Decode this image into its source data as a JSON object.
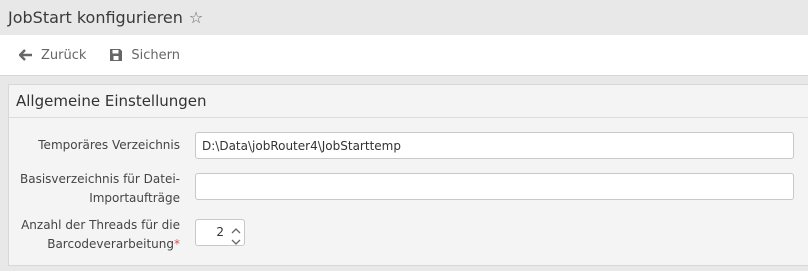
{
  "header": {
    "title": "JobStart konfigurieren",
    "star_icon": "star-outline-icon"
  },
  "toolbar": {
    "back_label": "Zurück",
    "back_icon": "arrow-left-icon",
    "save_label": "Sichern",
    "save_icon": "floppy-disk-icon"
  },
  "section": {
    "title": "Allgemeine Einstellungen"
  },
  "fields": {
    "temp_dir": {
      "label": "Temporäres Verzeichnis",
      "value": "D:\\Data\\jobRouter4\\JobStarttemp",
      "placeholder": ""
    },
    "base_dir": {
      "label_line1": "Basisverzeichnis für Datei-",
      "label_line2": "Importaufträge",
      "value": "",
      "placeholder": ""
    },
    "threads": {
      "label_line1": "Anzahl der Threads für die",
      "label_line2": "Barcodeverarbeitung",
      "required_mark": "*",
      "value": "2"
    }
  },
  "colors": {
    "required": "#d9534f",
    "background": "#e8e8e8",
    "panel": "#f4f4f4"
  }
}
